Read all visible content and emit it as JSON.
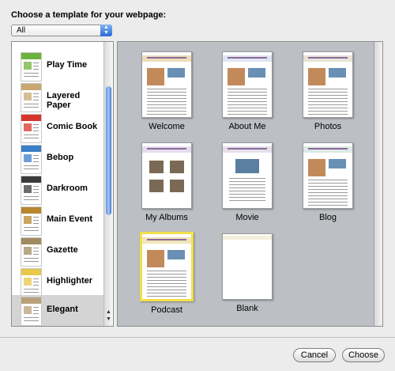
{
  "dialog": {
    "heading": "Choose a template for your webpage:",
    "filter": {
      "value": "All"
    }
  },
  "themes": [
    {
      "label": "Play Time",
      "selected": false,
      "color": "#6cb33c",
      "icon": "play-time-thumbnail-icon"
    },
    {
      "label": "Layered Paper",
      "selected": false,
      "color": "#c8a870",
      "icon": "layered-paper-thumbnail-icon"
    },
    {
      "label": "Comic Book",
      "selected": false,
      "color": "#d5352b",
      "icon": "comic-book-thumbnail-icon"
    },
    {
      "label": "Bebop",
      "selected": false,
      "color": "#3b7fc8",
      "icon": "bebop-thumbnail-icon"
    },
    {
      "label": "Darkroom",
      "selected": false,
      "color": "#3a3a3a",
      "icon": "darkroom-thumbnail-icon"
    },
    {
      "label": "Main Event",
      "selected": false,
      "color": "#b8862e",
      "icon": "main-event-thumbnail-icon"
    },
    {
      "label": "Gazette",
      "selected": false,
      "color": "#a08a60",
      "icon": "gazette-thumbnail-icon"
    },
    {
      "label": "Highlighter",
      "selected": false,
      "color": "#e8c84a",
      "icon": "highlighter-thumbnail-icon"
    },
    {
      "label": "Elegant",
      "selected": true,
      "color": "#b7a07a",
      "icon": "elegant-thumbnail-icon"
    }
  ],
  "templates": [
    {
      "label": "Welcome",
      "selected": false,
      "icon": "welcome-template-thumbnail"
    },
    {
      "label": "About Me",
      "selected": false,
      "icon": "about-me-template-thumbnail"
    },
    {
      "label": "Photos",
      "selected": false,
      "icon": "photos-template-thumbnail"
    },
    {
      "label": "My Albums",
      "selected": false,
      "icon": "my-albums-template-thumbnail"
    },
    {
      "label": "Movie",
      "selected": false,
      "icon": "movie-template-thumbnail"
    },
    {
      "label": "Blog",
      "selected": false,
      "icon": "blog-template-thumbnail"
    },
    {
      "label": "Podcast",
      "selected": true,
      "icon": "podcast-template-thumbnail"
    },
    {
      "label": "Blank",
      "selected": false,
      "icon": "blank-template-thumbnail"
    }
  ],
  "buttons": {
    "cancel": "Cancel",
    "choose": "Choose"
  }
}
